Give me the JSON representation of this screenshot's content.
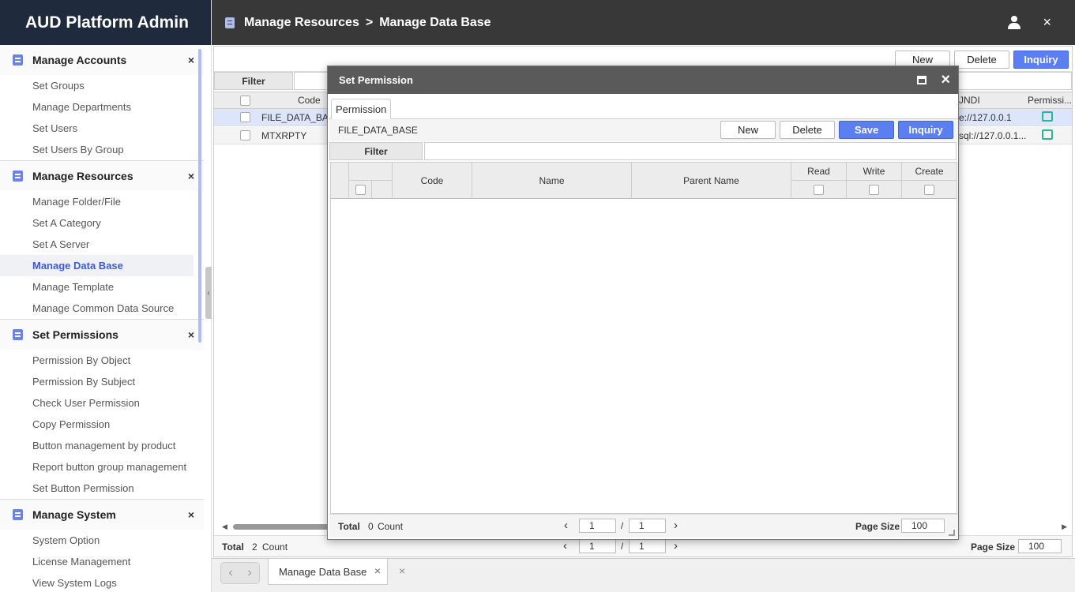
{
  "app": {
    "title": "AUD Platform Admin"
  },
  "topbar": {
    "section": "Manage Resources",
    "separator": ">",
    "page": "Manage Data Base"
  },
  "sidebar": {
    "groups": [
      {
        "title": "Manage Accounts",
        "items": [
          "Set Groups",
          "Manage Departments",
          "Set Users",
          "Set Users By Group"
        ]
      },
      {
        "title": "Manage Resources",
        "items": [
          "Manage Folder/File",
          "Set A Category",
          "Set A Server",
          "Manage Data Base",
          "Manage Template",
          "Manage Common Data Source"
        ]
      },
      {
        "title": "Set Permissions",
        "items": [
          "Permission By Object",
          "Permission By Subject",
          "Check User Permission",
          "Copy Permission",
          "Button management by product",
          "Report button group management",
          "Set Button Permission"
        ]
      },
      {
        "title": "Manage System",
        "items": [
          "System Option",
          "License Management",
          "View System Logs"
        ]
      }
    ],
    "close_symbol": "×"
  },
  "main": {
    "toolbar": {
      "new": "New",
      "delete": "Delete",
      "inquiry": "Inquiry"
    },
    "filter_label": "Filter",
    "columns": {
      "code": "Code",
      "jndi": "JNDI",
      "permission": "Permissi..."
    },
    "rows": [
      {
        "code": "FILE_DATA_BASE",
        "jndi": "e://127.0.0.1"
      },
      {
        "code": "MTXRPTY",
        "jndi": "sql://127.0.0.1..."
      }
    ],
    "footer": {
      "total_label": "Total",
      "count": "2",
      "count_label": "Count",
      "page": "1",
      "page_sep": "/",
      "pages": "1",
      "page_size_label": "Page Size",
      "page_size": "100"
    }
  },
  "modal": {
    "title": "Set Permission",
    "tab": "Permission",
    "subject": "FILE_DATA_BASE",
    "buttons": {
      "new": "New",
      "delete": "Delete",
      "save": "Save",
      "inquiry": "Inquiry"
    },
    "filter_label": "Filter",
    "columns": {
      "code": "Code",
      "name": "Name",
      "parent_name": "Parent Name",
      "read": "Read",
      "write": "Write",
      "create": "Create"
    },
    "footer": {
      "total_label": "Total",
      "count": "0",
      "count_label": "Count",
      "page": "1",
      "page_sep": "/",
      "pages": "1",
      "page_size_label": "Page Size",
      "page_size": "100"
    }
  },
  "bottom_tabs": {
    "active": "Manage Data Base"
  },
  "icons": {
    "close": "×",
    "prev": "‹",
    "next": "›"
  },
  "colors": {
    "brand_bg": "#1f2a3c",
    "topbar_bg": "#383838",
    "primary": "#5b7ef0",
    "accent_icon": "#6a84e0",
    "edit_icon": "#2bb597"
  }
}
